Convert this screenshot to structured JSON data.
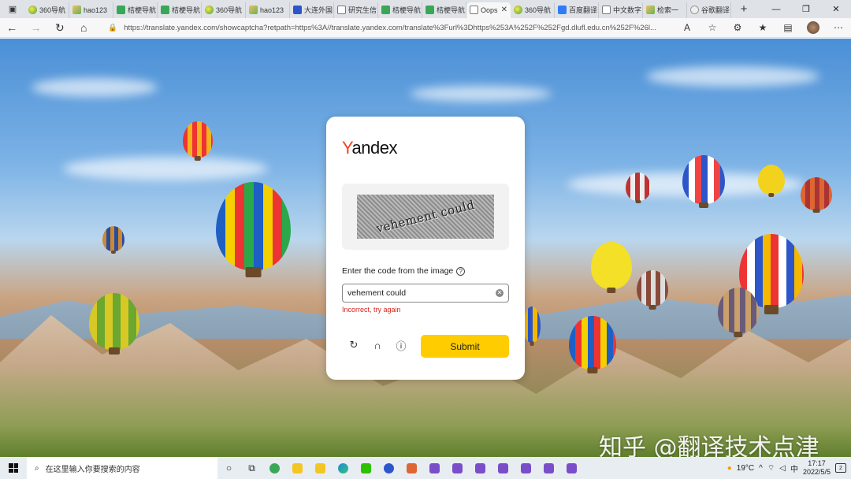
{
  "browser": {
    "tabs": [
      {
        "title": "360导航",
        "icon": "c360"
      },
      {
        "title": "hao123",
        "icon": "map"
      },
      {
        "title": "桔梗导航",
        "icon": "green"
      },
      {
        "title": "桔梗导航",
        "icon": "green"
      },
      {
        "title": "360导航",
        "icon": "c360"
      },
      {
        "title": "hao123",
        "icon": "map"
      },
      {
        "title": "大连外国",
        "icon": "blue"
      },
      {
        "title": "研究生信",
        "icon": "doc"
      },
      {
        "title": "桔梗导航",
        "icon": "green"
      },
      {
        "title": "桔梗导航",
        "icon": "green"
      },
      {
        "title": "Oops",
        "icon": "doc",
        "active": true
      },
      {
        "title": "360导航",
        "icon": "c360"
      },
      {
        "title": "百度翻译",
        "icon": "baidu"
      },
      {
        "title": "中文数字",
        "icon": "doc"
      },
      {
        "title": "检索一",
        "icon": "map"
      },
      {
        "title": "谷歌翻译",
        "icon": "search"
      }
    ],
    "url": "https://translate.yandex.com/showcaptcha?retpath=https%3A//translate.yandex.com/translate%3Furl%3Dhttps%253A%252F%252Fgd.dlufl.edu.cn%252F%26l..."
  },
  "captcha": {
    "logo_first": "Y",
    "logo_rest": "andex",
    "captcha_text": "vehement could",
    "prompt": "Enter the code from the image",
    "input_value": "vehement could",
    "error": "Incorrect, try again",
    "submit_label": "Submit"
  },
  "watermark": "知乎 @翻译技术点津",
  "taskbar": {
    "search_placeholder": "在这里输入你要搜索的内容",
    "temperature": "19°C",
    "ime": "中",
    "time": "17:17",
    "date": "2022/5/5",
    "notifications": "2"
  }
}
